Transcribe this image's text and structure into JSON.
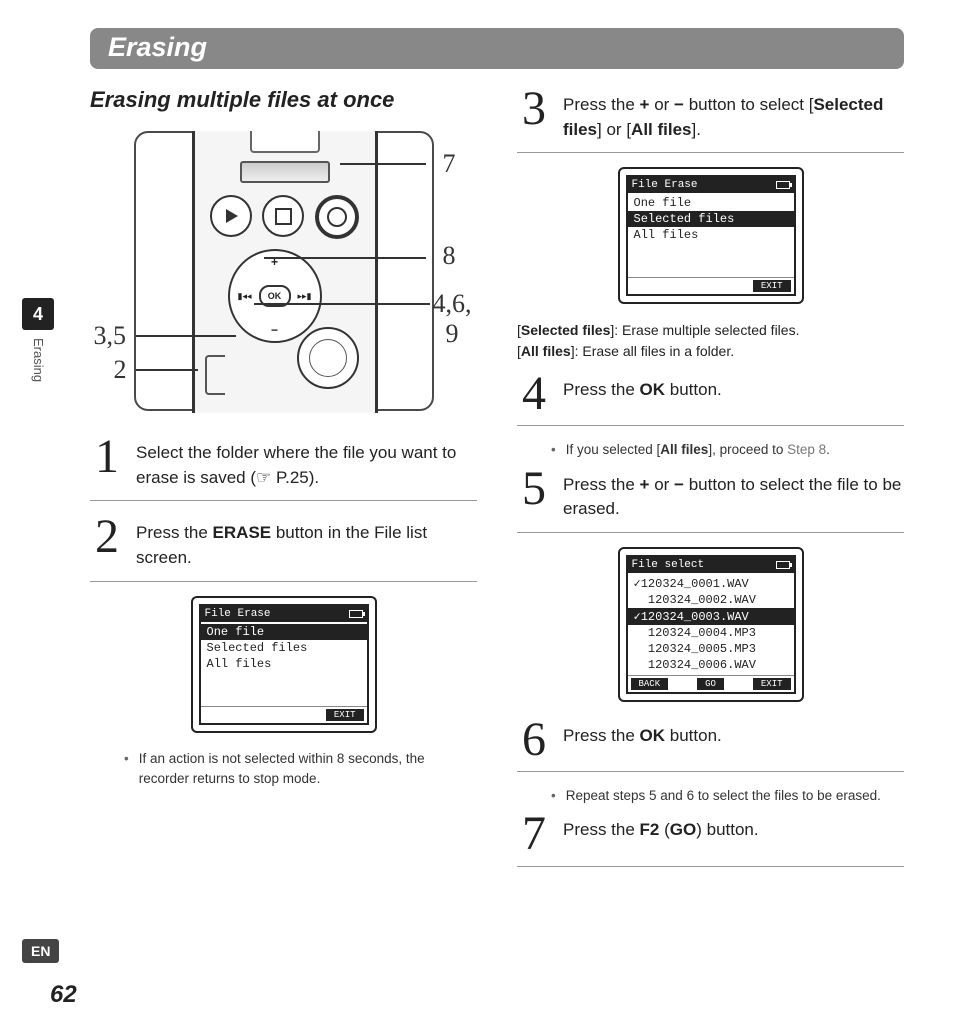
{
  "header": {
    "title": "Erasing"
  },
  "subheading": "Erasing multiple files at once",
  "sidebar": {
    "chapter_num": "4",
    "chapter_label": "Erasing"
  },
  "footer": {
    "lang": "EN",
    "page": "62"
  },
  "device_callouts": {
    "c7": "7",
    "c8": "8",
    "c469": "4,6,\n9",
    "c35": "3,5",
    "c2": "2"
  },
  "steps": {
    "s1": {
      "num": "1",
      "text_a": "Select the folder where the file you want to erase is saved (☞ P.25)."
    },
    "s2": {
      "num": "2",
      "text_a": "Press the ",
      "bold": "ERASE",
      "text_b": " button in the File list screen."
    },
    "s3": {
      "num": "3",
      "text_a": "Press the ",
      "b1": "+",
      "text_b": " or ",
      "b2": "−",
      "text_c": " button to select [",
      "b3": "Selected files",
      "text_d": "] or [",
      "b4": "All files",
      "text_e": "]."
    },
    "s4": {
      "num": "4",
      "text_a": "Press the ",
      "bold": "OK",
      "text_b": " button."
    },
    "s5": {
      "num": "5",
      "text_a": "Press the ",
      "b1": "+",
      "text_b": " or ",
      "b2": "−",
      "text_c": " button to select the file to be erased."
    },
    "s6": {
      "num": "6",
      "text_a": "Press the ",
      "bold": "OK",
      "text_b": " button."
    },
    "s7": {
      "num": "7",
      "text_a": "Press the ",
      "b1": "F2",
      "text_b": " (",
      "b2": "GO",
      "text_c": ") button."
    }
  },
  "notes": {
    "n2": "If an action is not selected within 8 seconds, the recorder returns to stop mode.",
    "n4_a": "If you selected [",
    "n4_b": "All files",
    "n4_c": "], proceed to ",
    "n4_d": "Step 8",
    "n4_e": ".",
    "n6": "Repeat steps 5 and 6 to select the files to be erased."
  },
  "desc3": {
    "a": "[",
    "b": "Selected files",
    "c": "]: Erase multiple selected files.",
    "d": "[",
    "e": "All files",
    "f": "]: Erase all files in a folder."
  },
  "lcd1": {
    "title": "File Erase",
    "rows": [
      "One file",
      "Selected files",
      "All files"
    ],
    "selected_index": 0,
    "foot": [
      "EXIT"
    ]
  },
  "lcd2": {
    "title": "File Erase",
    "rows": [
      "One file",
      "Selected files",
      "All files"
    ],
    "selected_index": 1,
    "foot": [
      "EXIT"
    ]
  },
  "lcd3": {
    "title": "File select",
    "rows": [
      {
        "check": true,
        "name": "120324_0001.WAV",
        "sel": false
      },
      {
        "check": false,
        "name": "120324_0002.WAV",
        "sel": false
      },
      {
        "check": true,
        "name": "120324_0003.WAV",
        "sel": true
      },
      {
        "check": false,
        "name": "120324_0004.MP3",
        "sel": false
      },
      {
        "check": false,
        "name": "120324_0005.MP3",
        "sel": false
      },
      {
        "check": false,
        "name": "120324_0006.WAV",
        "sel": false
      }
    ],
    "foot": [
      "BACK",
      "GO",
      "EXIT"
    ]
  },
  "ok_label": "OK"
}
